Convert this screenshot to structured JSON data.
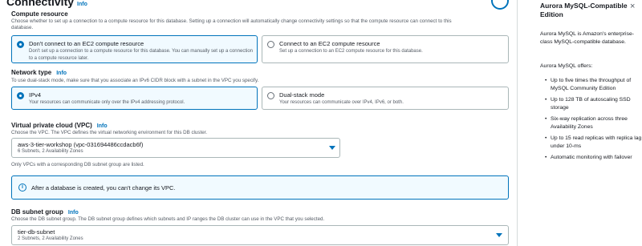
{
  "connectivity": {
    "title": "Connectivity",
    "info": "Info"
  },
  "compute_resource": {
    "label": "Compute resource",
    "description": "Choose whether to set up a connection to a compute resource for this database. Setting up a connection will automatically change connectivity settings so that the compute resource can connect to this",
    "description_line2": "database.",
    "options": [
      {
        "title": "Don't connect to an EC2 compute resource",
        "subtitle": "Don't set up a connection to a compute resource for this database. You can manually set up a connection to a compute resource later.",
        "selected": true
      },
      {
        "title": "Connect to an EC2 compute resource",
        "subtitle": "Set up a connection to an EC2 compute resource for this database.",
        "selected": false
      }
    ]
  },
  "network_type": {
    "label": "Network type",
    "info": "Info",
    "description": "To use dual-stack mode, make sure that you associate an IPv6 CIDR block with a subnet in the VPC you specify.",
    "options": [
      {
        "title": "IPv4",
        "subtitle": "Your resources can communicate only over the IPv4 addressing protocol.",
        "selected": true
      },
      {
        "title": "Dual-stack mode",
        "subtitle": "Your resources can communicate over IPv4, IPv6, or both.",
        "selected": false
      }
    ]
  },
  "vpc": {
    "label": "Virtual private cloud (VPC)",
    "info": "Info",
    "description": "Choose the VPC. The VPC defines the virtual networking environment for this DB cluster.",
    "value": "aws-3-tier-workshop (vpc-031694486ccdacb6f)",
    "subvalue": "6 Subnets, 2 Availability Zones",
    "note": "Only VPCs with a corresponding DB subnet group are listed.",
    "alert": "After a database is created, you can't change its VPC."
  },
  "subnet_group": {
    "label": "DB subnet group",
    "info": "Info",
    "description": "Choose the DB subnet group. The DB subnet group defines which subnets and IP ranges the DB cluster can use in the VPC that you selected.",
    "value": "tier-db-subnet",
    "subvalue": "2 Subnets, 2 Availability Zones"
  },
  "side_panel": {
    "title": "Aurora MySQL-Compatible Edition",
    "intro": "Aurora MySQL is Amazon's enterprise-class MySQL-compatible database.",
    "offers": "Aurora MySQL offers:",
    "bullets": [
      "Up to five times the throughput of MySQL Community Edition",
      "Up to 128 TB of autoscaling SSD storage",
      "Six-way replication across three Availability Zones",
      "Up to 15 read replicas with replica lag under 10-ms",
      "Automatic monitoring with failover"
    ],
    "close": "×"
  },
  "colors": {
    "accent": "#0073bb",
    "selected_bg": "#f1faff",
    "border": "#aab7b8"
  }
}
